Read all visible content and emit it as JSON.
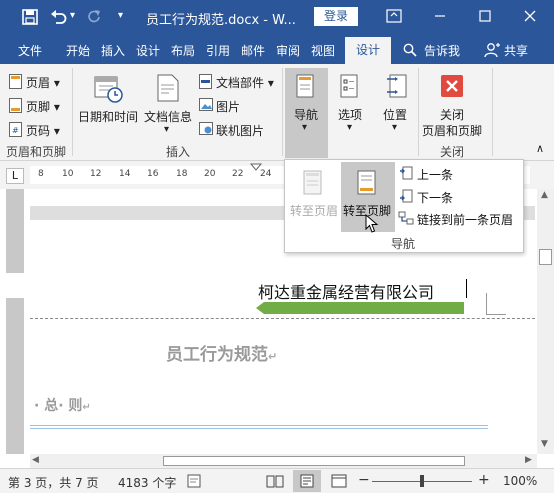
{
  "titlebar": {
    "doc_title": "员工行为规范.docx - W...",
    "login_label": "登录",
    "customize_glyph": "▾"
  },
  "tabs": [
    "文件",
    "开始",
    "插入",
    "设计",
    "布局",
    "引用",
    "邮件",
    "审阅",
    "视图",
    "设计"
  ],
  "tell_me": "告诉我",
  "share": "共享",
  "ribbon": {
    "header_label": "页眉",
    "footer_label": "页脚",
    "pagenum_label": "页码",
    "group1_label": "页眉和页脚",
    "datetime_label": "日期和时间",
    "docinfo_label": "文档信息",
    "docparts_label": "文档部件",
    "picture_label": "图片",
    "onlinepic_label": "联机图片",
    "insert_group_label": "插入",
    "nav_label": "导航",
    "options_label": "选项",
    "position_label": "位置",
    "close_label_1": "关闭",
    "close_label_2": "页眉和页脚",
    "close_group_label": "关闭"
  },
  "ruler": {
    "tab_selector": "L",
    "ticks": [
      "8",
      "10",
      "12",
      "14",
      "16",
      "18",
      "20",
      "22",
      "24"
    ]
  },
  "nav_panel": {
    "goto_header": "转至页眉",
    "goto_footer": "转至页脚",
    "prev": "上一条",
    "next": "下一条",
    "link_prev": "链接到前一条页眉",
    "group_label": "导航"
  },
  "document": {
    "header_text": "柯达重金属经营有限公司",
    "title": "员工行为规范",
    "section": "· 总· 则"
  },
  "status": {
    "page_info": "第 3 页，共 7 页",
    "word_count": "4183 个字",
    "zoom": "100%"
  },
  "colors": {
    "brand": "#2b579a",
    "accent_green": "#70ad47",
    "close_red": "#e04a3f"
  }
}
